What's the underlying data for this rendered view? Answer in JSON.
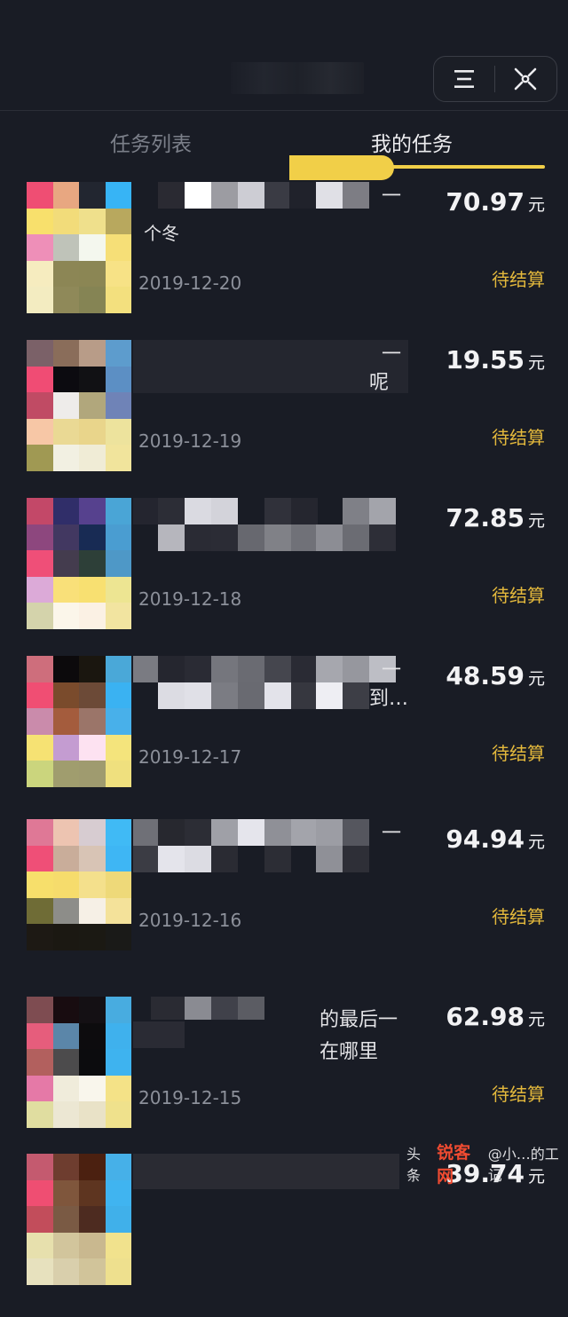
{
  "header": {
    "menu_icon": "menu-icon",
    "close_icon": "close-icon"
  },
  "tabs": [
    {
      "label": "任务列表",
      "active": false
    },
    {
      "label": "我的任务",
      "active": true
    }
  ],
  "currency_unit": "元",
  "tasks": [
    {
      "title_fragment_1": "一",
      "title_fragment_2": "个冬",
      "amount": "70.97",
      "date": "2019-12-20",
      "status": "待结算"
    },
    {
      "title_fragment_1": "一",
      "title_fragment_2": "呢",
      "amount": "19.55",
      "date": "2019-12-19",
      "status": "待结算"
    },
    {
      "title_fragment_1": "",
      "title_fragment_2": "",
      "amount": "72.85",
      "date": "2019-12-18",
      "status": "待结算"
    },
    {
      "title_fragment_1": "一",
      "title_fragment_2": "到…",
      "amount": "48.59",
      "date": "2019-12-17",
      "status": "待结算"
    },
    {
      "title_fragment_1": "一",
      "title_fragment_2": "",
      "amount": "94.94",
      "date": "2019-12-16",
      "status": "待结算"
    },
    {
      "title_fragment_1": "的最后一",
      "title_fragment_2": "在哪里",
      "amount": "62.98",
      "date": "2019-12-15",
      "status": "待结算"
    },
    {
      "title_fragment_1": "",
      "title_fragment_2": "",
      "amount": "39.74",
      "date": "",
      "status": ""
    }
  ],
  "watermark": {
    "source": "头条",
    "logo": "锐客网",
    "author": "@小…的工记"
  },
  "colors": {
    "background": "#191c25",
    "accent": "#f1cf48",
    "status": "#e3b83c"
  }
}
